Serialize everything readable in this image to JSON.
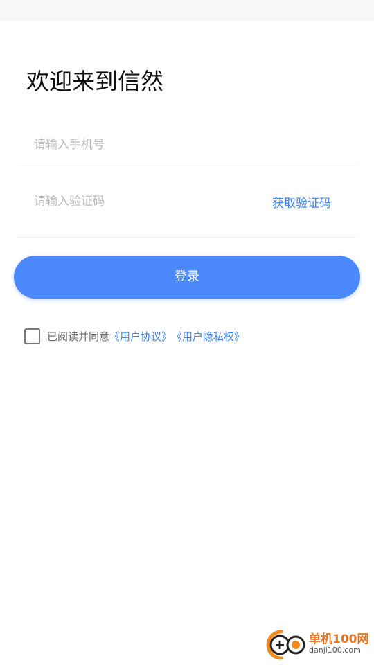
{
  "page": {
    "title": "欢迎来到信然"
  },
  "phone": {
    "placeholder": "请输入手机号"
  },
  "code": {
    "placeholder": "请输入验证码",
    "get_code_label": "获取验证码"
  },
  "login": {
    "label": "登录"
  },
  "agreement": {
    "prefix": "已阅读并同意",
    "user_agreement": "《用户协议》",
    "privacy_policy": "《用户隐私权》"
  },
  "watermark": {
    "name": "单机100网",
    "domain": "danji100.com"
  },
  "colors": {
    "accent": "#4a88fb",
    "link": "#3e82e6",
    "watermark": "#e8731a"
  }
}
